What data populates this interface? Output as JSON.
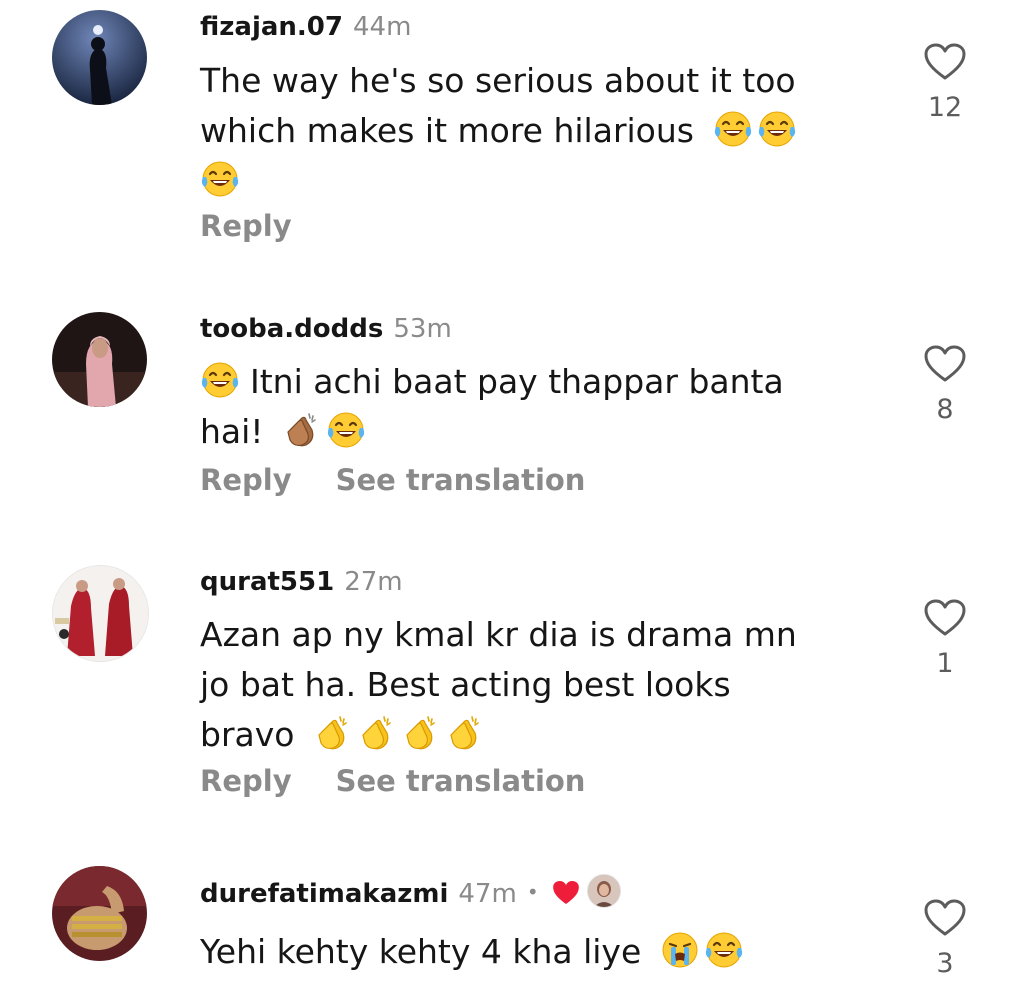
{
  "comments": [
    {
      "username": "fizajan.07",
      "time": "44m",
      "text_line1": "The way he's so serious about it too",
      "text_line2": "which makes it more hilarious",
      "emojis": [
        "laughing-tears-emoji",
        "laughing-tears-emoji",
        "laughing-tears-emoji"
      ],
      "reply_label": "Reply",
      "likes": "12"
    },
    {
      "username": "tooba.dodds",
      "time": "53m",
      "text_line1": "Itni achi baat pay thappar banta",
      "text_line2": "hai!",
      "emojis": [
        "laughing-tears-emoji",
        "clapping-hands-emoji",
        "laughing-tears-emoji"
      ],
      "reply_label": "Reply",
      "translate_label": "See translation",
      "likes": "8"
    },
    {
      "username": "qurat551",
      "time": "27m",
      "text_line1": "Azan ap ny kmal kr dia is drama mn",
      "text_line2": "jo bat ha. Best acting best looks",
      "text_line3": "bravo",
      "emojis": [
        "clapping-hands-emoji",
        "clapping-hands-emoji",
        "clapping-hands-emoji",
        "clapping-hands-emoji"
      ],
      "reply_label": "Reply",
      "translate_label": "See translation",
      "likes": "1"
    },
    {
      "username": "durefatimakazmi",
      "time": "47m",
      "separator": "•",
      "creator_liked": true,
      "text_line1": "Yehi kehty kehty 4 kha liye",
      "emojis": [
        "crying-emoji",
        "laughing-tears-emoji"
      ],
      "likes": "3"
    }
  ],
  "colors": {
    "text": "#161616",
    "muted": "#8a8a8a",
    "like_count": "#5c5c5c",
    "heart_red": "#fe2c55"
  }
}
